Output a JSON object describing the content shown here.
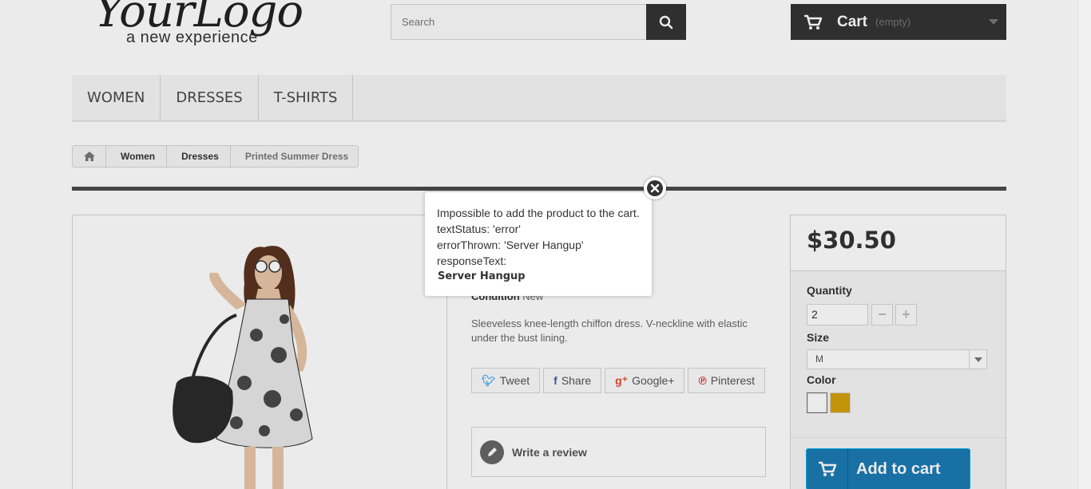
{
  "header": {
    "logo_main": "YourLogo",
    "logo_sub": "a new experience",
    "search_placeholder": "Search",
    "cart_label": "Cart",
    "cart_quantity": "(empty)"
  },
  "menu": {
    "items": [
      "WOMEN",
      "DRESSES",
      "T-SHIRTS"
    ]
  },
  "breadcrumb": {
    "links": [
      "Women",
      "Dresses"
    ],
    "current": "Printed Summer Dress"
  },
  "product": {
    "condition_label": "Condition",
    "condition_value": "New",
    "description": "Sleeveless knee-length chiffon dress. V-neckline with elastic under the bust lining.",
    "social": [
      "Tweet",
      "Share",
      "Google+",
      "Pinterest"
    ],
    "review_label": "Write a review"
  },
  "buy_box": {
    "price": "$30.50",
    "quantity_label": "Quantity",
    "quantity_value": "2",
    "minus_label": "−",
    "plus_label": "+",
    "size_label": "Size",
    "size_value": "M",
    "color_label": "Color",
    "colors": [
      "#ffffff",
      "#f1c40f"
    ],
    "add_label": "Add to cart"
  },
  "popup": {
    "line1": "Impossible to add the product to the cart.",
    "line2": "textStatus: 'error'",
    "line3": "errorThrown: 'Server Hangup'",
    "line4": "responseText:",
    "line5": "Server Hangup"
  }
}
